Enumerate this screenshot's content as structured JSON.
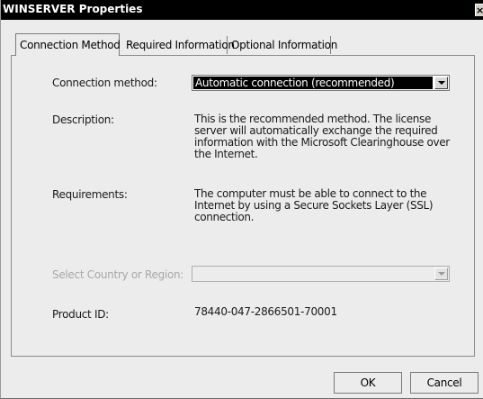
{
  "window": {
    "title": "WINSERVER Properties",
    "close_glyph": "×"
  },
  "tabs": [
    {
      "label": "Connection Method"
    },
    {
      "label": "Required Information"
    },
    {
      "label": "Optional Information"
    }
  ],
  "form": {
    "connection_method_label": "Connection method:",
    "connection_method_value": "Automatic connection (recommended)",
    "description_label": "Description:",
    "description_text": "This is the recommended method. The license server will automatically exchange the required information with the Microsoft Clearinghouse over the Internet.",
    "requirements_label": "Requirements:",
    "requirements_text": "The computer must be able to connect to the Internet by using a Secure Sockets Layer (SSL) connection.",
    "country_label": "Select Country or Region:",
    "country_value": "",
    "product_id_label": "Product ID:",
    "product_id_value": "78440-047-2866501-70001"
  },
  "buttons": {
    "ok": "OK",
    "cancel": "Cancel"
  }
}
